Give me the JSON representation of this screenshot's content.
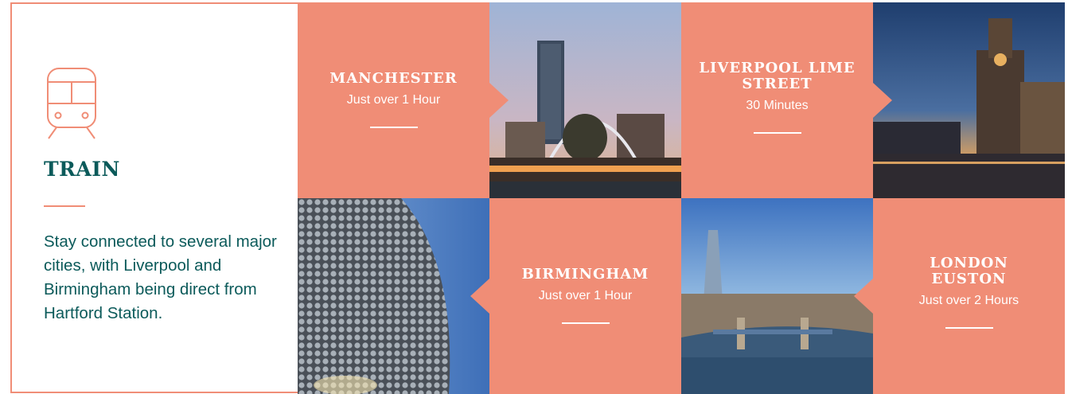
{
  "intro": {
    "title": "TRAIN",
    "description": "Stay connected to several major cities, with Liverpool and Birmingham being direct from Hartford Station."
  },
  "destinations": [
    {
      "city": "MANCHESTER",
      "duration": "Just over 1 Hour",
      "photo": "manchester-bridge-skyline"
    },
    {
      "city": "LIVERPOOL LIME STREET",
      "duration": "30 Minutes",
      "photo": "liverpool-waterfront"
    },
    {
      "city": "BIRMINGHAM",
      "duration": "Just over 1 Hour",
      "photo": "birmingham-bullring"
    },
    {
      "city": "LONDON EUSTON",
      "duration": "Just over 2 Hours",
      "photo": "london-tower-bridge"
    }
  ],
  "colors": {
    "accent": "#f08d76",
    "text": "#0b5a5a",
    "white": "#ffffff"
  },
  "icons": {
    "transport": "train-icon"
  }
}
